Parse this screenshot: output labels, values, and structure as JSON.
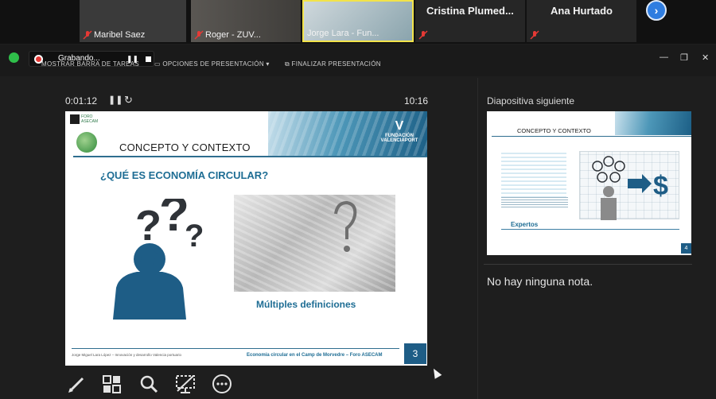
{
  "participants": [
    {
      "name": "Maribel Saez",
      "muted": true
    },
    {
      "name": "Roger - ZUV...",
      "muted": true
    },
    {
      "name": "Jorge Lara - Fun...",
      "muted": false
    },
    {
      "name": "Cristina  Plumed...",
      "muted": true
    },
    {
      "name": "Ana Hurtado",
      "muted": true
    }
  ],
  "next_page_icon": "chevron-right-icon",
  "recording": {
    "label": "Grabando..."
  },
  "toolbar": {
    "show_taskbar": "MOSTRAR BARRA DE TAREAS",
    "presentation_options": "OPCIONES DE PRESENTACIÓN ▾",
    "end_presentation": "FINALIZAR PRESENTACIÓN"
  },
  "presenter": {
    "elapsed": "0:01:12",
    "clock": "10:16"
  },
  "current_slide": {
    "title": "CONCEPTO Y CONTEXTO",
    "question": "¿QUÉ ES ECONOMÍA CIRCULAR?",
    "caption": "Múltiples definiciones",
    "brand": "FUNDACIÓN VALENCIAPORT",
    "logo_text": "FORO ASECAM",
    "footer_left": "Jorge Miguel Lara López – Innovación y desarrollo Valencia portuario",
    "footer_right": "Economía circular en el Camp de Morvedre – Foro ASECAM",
    "number": "3"
  },
  "next_slide": {
    "label": "Diapositiva siguiente",
    "title": "CONCEPTO Y CONTEXTO",
    "expertos": "Expertos",
    "number": "4"
  },
  "notes": "No hay ninguna nota.",
  "colors": {
    "accent": "#1e6d94",
    "slide_blue": "#1e5d86",
    "recording": "#e53935"
  }
}
